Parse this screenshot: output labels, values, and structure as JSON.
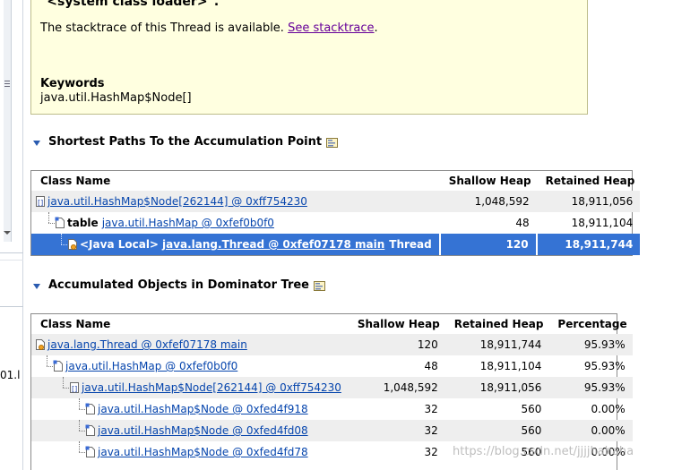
{
  "left": {
    "fragment": "01.l"
  },
  "info": {
    "heading": "\"<system class loader>\".",
    "stacktrace_prefix": "The stacktrace of this Thread is available.",
    "stacktrace_link": "See stacktrace",
    "stacktrace_suffix": ".",
    "keywords_title": "Keywords",
    "keywords_value": "java.util.HashMap$Node[]"
  },
  "sections": {
    "shortest": {
      "title": "Shortest Paths To the Accumulation Point"
    },
    "accumulated": {
      "title": "Accumulated Objects in Dominator Tree"
    }
  },
  "paths_table": {
    "columns": [
      "Class Name",
      "Shallow Heap",
      "Retained Heap"
    ],
    "rows": [
      {
        "link": "java.util.HashMap$Node[262144] @ 0xff754230",
        "shallow": "1,048,592",
        "retained": "18,911,056"
      },
      {
        "prefix": "table",
        "link": "java.util.HashMap @ 0xfef0b0f0",
        "shallow": "48",
        "retained": "18,911,104"
      },
      {
        "prefix": "<Java Local>",
        "link": "java.lang.Thread @ 0xfef07178 main",
        "suffix": "Thread",
        "shallow": "120",
        "retained": "18,911,744"
      }
    ]
  },
  "dom_table": {
    "columns": [
      "Class Name",
      "Shallow Heap",
      "Retained Heap",
      "Percentage"
    ],
    "rows": [
      {
        "link": "java.lang.Thread @ 0xfef07178 main",
        "shallow": "120",
        "retained": "18,911,744",
        "pct": "95.93%"
      },
      {
        "link": "java.util.HashMap @ 0xfef0b0f0",
        "shallow": "48",
        "retained": "18,911,104",
        "pct": "95.93%"
      },
      {
        "link": "java.util.HashMap$Node[262144] @ 0xff754230",
        "shallow": "1,048,592",
        "retained": "18,911,056",
        "pct": "95.93%"
      },
      {
        "link": "java.util.HashMap$Node @ 0xfed4f918",
        "shallow": "32",
        "retained": "560",
        "pct": "0.00%"
      },
      {
        "link": "java.util.HashMap$Node @ 0xfed4fd08",
        "shallow": "32",
        "retained": "560",
        "pct": "0.00%"
      },
      {
        "link": "java.util.HashMap$Node @ 0xfed4fd78",
        "shallow": "32",
        "retained": "560",
        "pct": "0.00%"
      }
    ]
  },
  "watermark": "https://blog.csdn.net/jjjjhahaha",
  "colors": {
    "info_bg": "#ffffe0",
    "selection": "#3573d4",
    "link": "#0645ad",
    "visited_link": "#660099",
    "section_arrow": "#2a5bb0"
  },
  "icons": {
    "object": "object-icon",
    "array": "array-object-icon",
    "thread": "thread-icon",
    "explain": "explain-query-icon"
  }
}
